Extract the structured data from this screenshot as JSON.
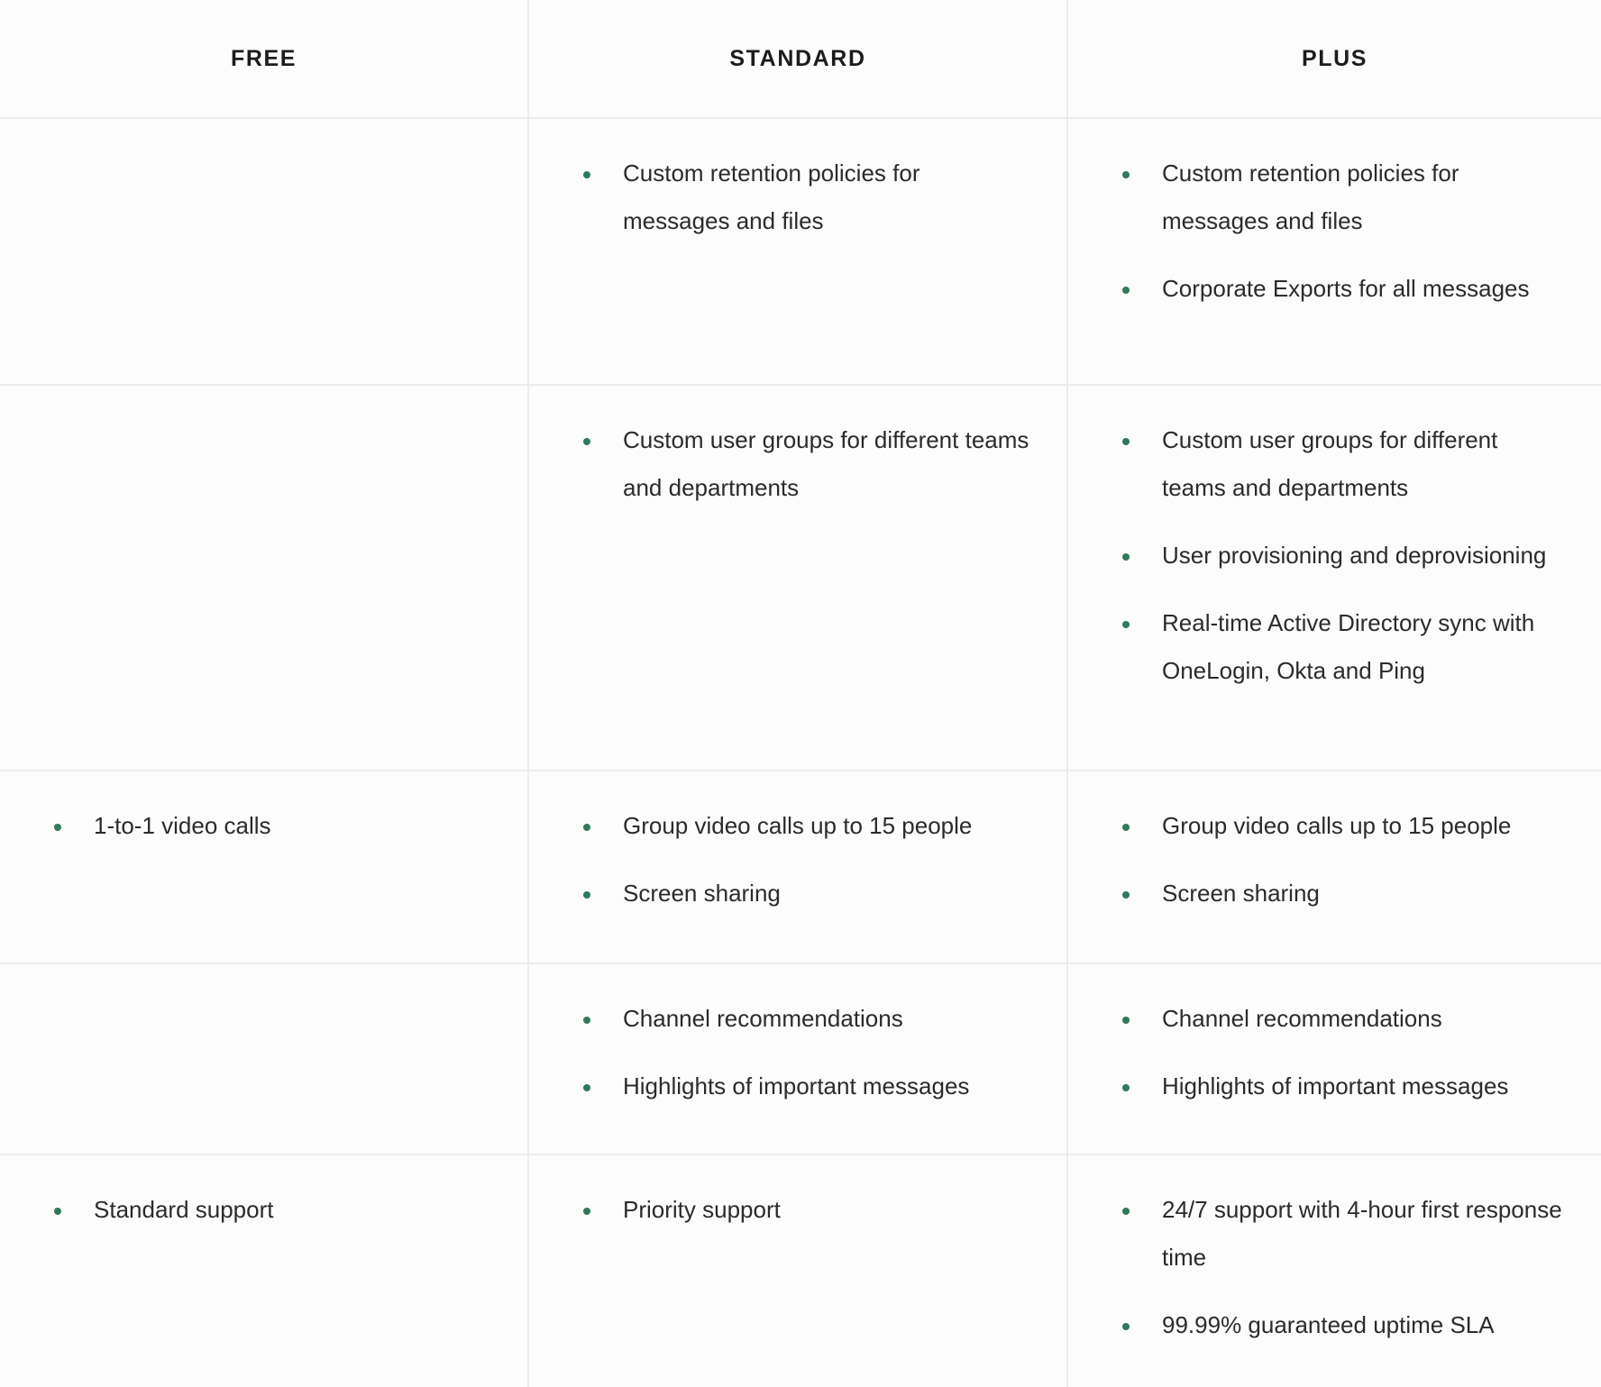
{
  "theme": {
    "page_background": "#ffffff",
    "cell_background": "#fcfcfc",
    "border_color": "#ececec",
    "header_text_color": "#1d1c1d",
    "body_text_color": "#2b2b2b",
    "bullet_color": "#2f7a5b"
  },
  "table": {
    "columns": [
      {
        "key": "free",
        "label": "FREE"
      },
      {
        "key": "standard",
        "label": "STANDARD"
      },
      {
        "key": "plus",
        "label": "PLUS"
      }
    ],
    "rows": [
      {
        "name": "retention-and-exports",
        "free": [],
        "standard": [
          "Custom retention policies for messages and files"
        ],
        "plus": [
          "Custom retention policies for messages and files",
          "Corporate Exports for all messages"
        ]
      },
      {
        "name": "user-groups-and-provisioning",
        "free": [],
        "standard": [
          "Custom user groups for different teams and departments"
        ],
        "plus": [
          "Custom user groups for different teams and departments",
          "User provisioning and deprovisioning",
          "Real-time Active Directory sync with OneLogin, Okta and Ping"
        ]
      },
      {
        "name": "video-calls-and-screen-sharing",
        "free": [
          "1-to-1 video calls"
        ],
        "standard": [
          "Group video calls up to 15 people",
          "Screen sharing"
        ],
        "plus": [
          "Group video calls up to 15 people",
          "Screen sharing"
        ]
      },
      {
        "name": "recommendations-and-highlights",
        "free": [],
        "standard": [
          "Channel recommendations",
          "Highlights of important messages"
        ],
        "plus": [
          "Channel recommendations",
          "Highlights of important messages"
        ]
      },
      {
        "name": "support",
        "free": [
          "Standard support"
        ],
        "standard": [
          "Priority support"
        ],
        "plus": [
          "24/7 support with 4-hour first response time",
          "99.99% guaranteed uptime SLA"
        ]
      }
    ]
  }
}
